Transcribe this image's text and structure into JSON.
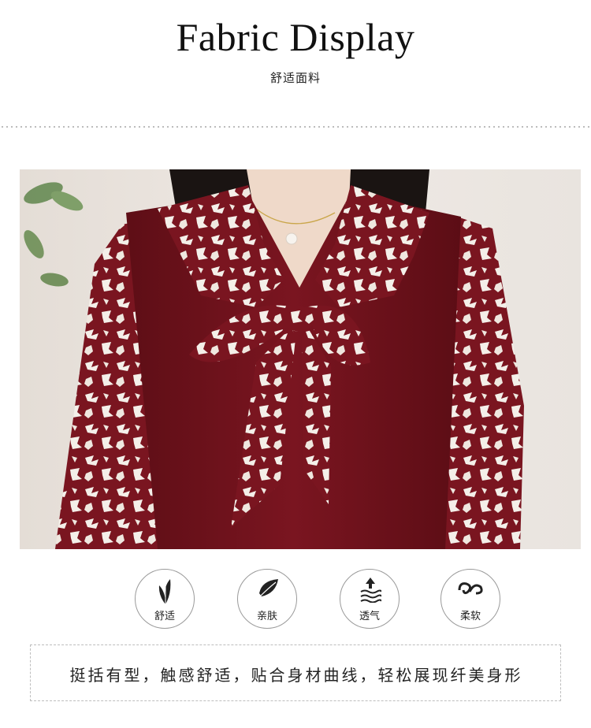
{
  "header": {
    "title": "Fabric  Display",
    "subtitle": "舒适面料"
  },
  "photo": {
    "subject": "red-floral-blouse-with-bow"
  },
  "features": [
    {
      "icon": "leaf-icon",
      "label": "舒适"
    },
    {
      "icon": "skin-icon",
      "label": "亲肤"
    },
    {
      "icon": "airflow-icon",
      "label": "透气"
    },
    {
      "icon": "soft-swirl-icon",
      "label": "柔软"
    }
  ],
  "description": "挺括有型，触感舒适，贴合身材曲线，轻松展现纤美身形",
  "colors": {
    "fabric_red": "#7a1520",
    "print_white": "#f4efe9",
    "background": "#ece6e1"
  }
}
